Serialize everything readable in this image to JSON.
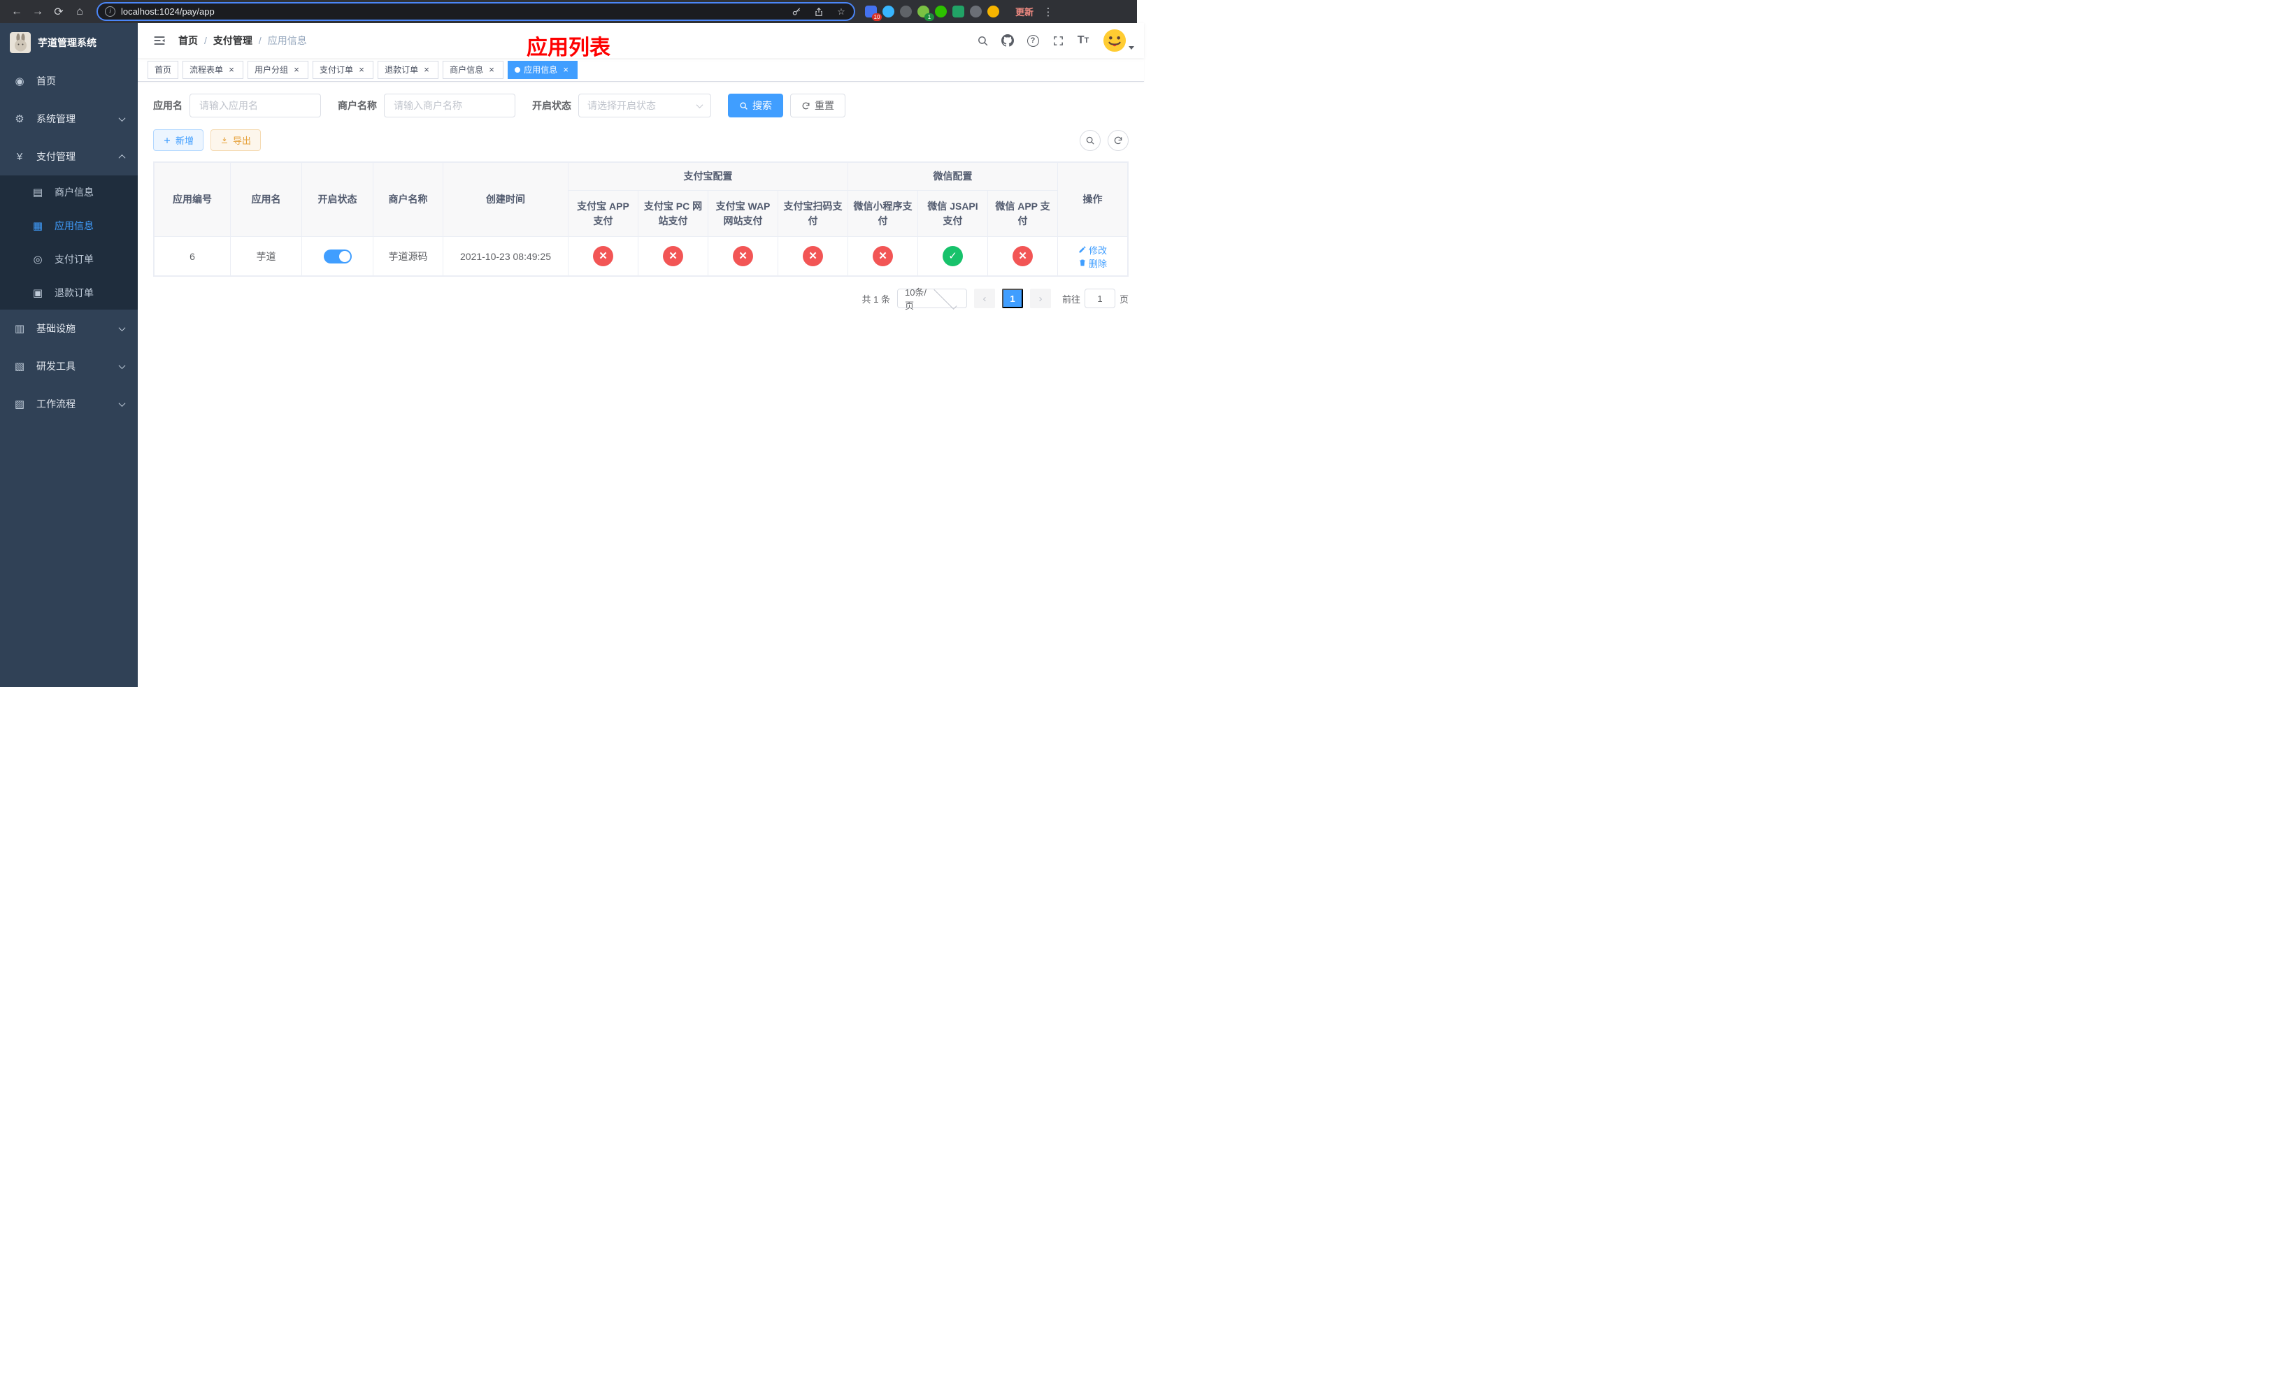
{
  "browser": {
    "url": "localhost:1024/pay/app",
    "update_label": "更新",
    "ext_badge_blue": "10",
    "ext_badge_green": "1"
  },
  "sidebar": {
    "title": "芋道管理系统",
    "home": "首页",
    "system": "系统管理",
    "payment": "支付管理",
    "merchant_info": "商户信息",
    "app_info": "应用信息",
    "pay_order": "支付订单",
    "refund_order": "退款订单",
    "infrastructure": "基础设施",
    "dev_tools": "研发工具",
    "workflow": "工作流程"
  },
  "breadcrumb": {
    "home": "首页",
    "payment": "支付管理",
    "current": "应用信息",
    "separator": "/"
  },
  "page_title": "应用列表",
  "tabs": {
    "t0": "首页",
    "t1": "流程表单",
    "t2": "用户分组",
    "t3": "支付订单",
    "t4": "退款订单",
    "t5": "商户信息",
    "t6": "应用信息"
  },
  "filters": {
    "app_name_label": "应用名",
    "app_name_placeholder": "请输入应用名",
    "merchant_label": "商户名称",
    "merchant_placeholder": "请输入商户名称",
    "status_label": "开启状态",
    "status_placeholder": "请选择开启状态",
    "search_label": "搜索",
    "reset_label": "重置"
  },
  "toolbar": {
    "add_label": "新增",
    "export_label": "导出"
  },
  "table": {
    "headers": {
      "app_id": "应用编号",
      "app_name": "应用名",
      "status": "开启状态",
      "merchant": "商户名称",
      "created": "创建时间",
      "alipay_group": "支付宝配置",
      "wechat_group": "微信配置",
      "alipay_app": "支付宝 APP 支付",
      "alipay_pc": "支付宝 PC 网站支付",
      "alipay_wap": "支付宝 WAP 网站支付",
      "alipay_qr": "支付宝扫码支付",
      "wx_mini": "微信小程序支付",
      "wx_jsapi": "微信 JSAPI 支付",
      "wx_app": "微信 APP 支付",
      "actions": "操作"
    },
    "row": {
      "id": "6",
      "name": "芋道",
      "enabled": "on",
      "merchant": "芋道源码",
      "created": "2021-10-23 08:49:25",
      "alipay_app": "fail",
      "alipay_pc": "fail",
      "alipay_wap": "fail",
      "alipay_qr": "fail",
      "wx_mini": "fail",
      "wx_jsapi": "success",
      "wx_app": "fail",
      "edit_label": "修改",
      "delete_label": "删除"
    }
  },
  "pagination": {
    "total": "共 1 条",
    "page_size": "10条/页",
    "page": "1",
    "prev": "‹",
    "next": "›",
    "goto_prefix": "前往",
    "goto_value": "1",
    "goto_suffix": "页"
  }
}
